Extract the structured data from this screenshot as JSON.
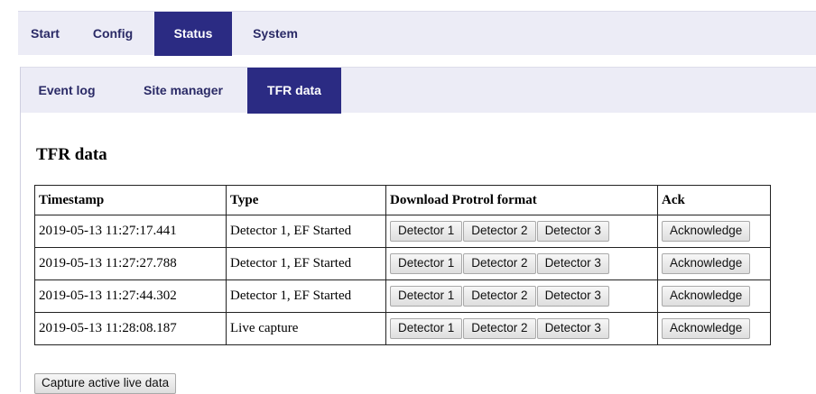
{
  "top_nav": {
    "tabs": [
      {
        "label": "Start"
      },
      {
        "label": "Config"
      },
      {
        "label": "Status",
        "active": true
      },
      {
        "label": "System"
      }
    ]
  },
  "sub_nav": {
    "tabs": [
      {
        "label": "Event log"
      },
      {
        "label": "Site manager"
      },
      {
        "label": "TFR data",
        "active": true
      }
    ]
  },
  "page_title": "TFR data",
  "table": {
    "headers": [
      "Timestamp",
      "Type",
      "Download Protrol format",
      "Ack"
    ],
    "rows": [
      {
        "timestamp": "2019-05-13 11:27:17.441",
        "type": "Detector 1, EF Started",
        "downloads": [
          "Detector 1",
          "Detector 2",
          "Detector 3"
        ],
        "ack": "Acknowledge"
      },
      {
        "timestamp": "2019-05-13 11:27:27.788",
        "type": "Detector 1, EF Started",
        "downloads": [
          "Detector 1",
          "Detector 2",
          "Detector 3"
        ],
        "ack": "Acknowledge"
      },
      {
        "timestamp": "2019-05-13 11:27:44.302",
        "type": "Detector 1, EF Started",
        "downloads": [
          "Detector 1",
          "Detector 2",
          "Detector 3"
        ],
        "ack": "Acknowledge"
      },
      {
        "timestamp": "2019-05-13 11:28:08.187",
        "type": "Live capture",
        "downloads": [
          "Detector 1",
          "Detector 2",
          "Detector 3"
        ],
        "ack": "Acknowledge"
      }
    ]
  },
  "capture_button_label": "Capture active live data",
  "colors": {
    "nav_background": "#ececf6",
    "nav_active": "#2b2b83",
    "nav_text": "#2a2a66"
  }
}
